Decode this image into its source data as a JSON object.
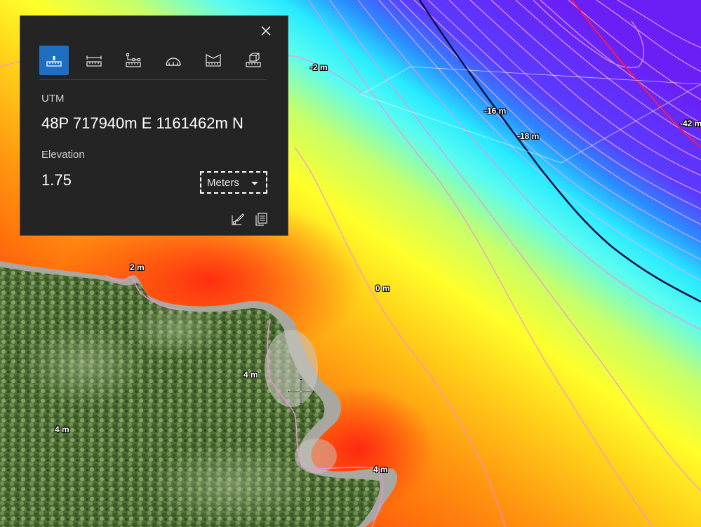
{
  "map": {
    "contour_labels": [
      {
        "id": "c1",
        "text": "-2 m"
      },
      {
        "id": "c2",
        "text": "-16 m"
      },
      {
        "id": "c3",
        "text": "-18 m"
      },
      {
        "id": "c4",
        "text": "-42 m"
      },
      {
        "id": "c5",
        "text": "2 m"
      },
      {
        "id": "c6",
        "text": "0 m"
      },
      {
        "id": "c7",
        "text": "4 m"
      },
      {
        "id": "c8",
        "text": "4 m"
      },
      {
        "id": "c9",
        "text": "4 m"
      }
    ]
  },
  "panel": {
    "coordinate_label": "UTM",
    "coordinate_value": "48P 717940m E 1161462m N",
    "elevation_label": "Elevation",
    "elevation_value": "1.75",
    "units_selected": "Meters",
    "tools": [
      {
        "name": "location",
        "active": true
      },
      {
        "name": "distance",
        "active": false
      },
      {
        "name": "multi-point",
        "active": false
      },
      {
        "name": "angle",
        "active": false
      },
      {
        "name": "area",
        "active": false
      },
      {
        "name": "volume",
        "active": false
      }
    ],
    "accent_color": "#1e6fc4",
    "background_color": "#242424"
  }
}
